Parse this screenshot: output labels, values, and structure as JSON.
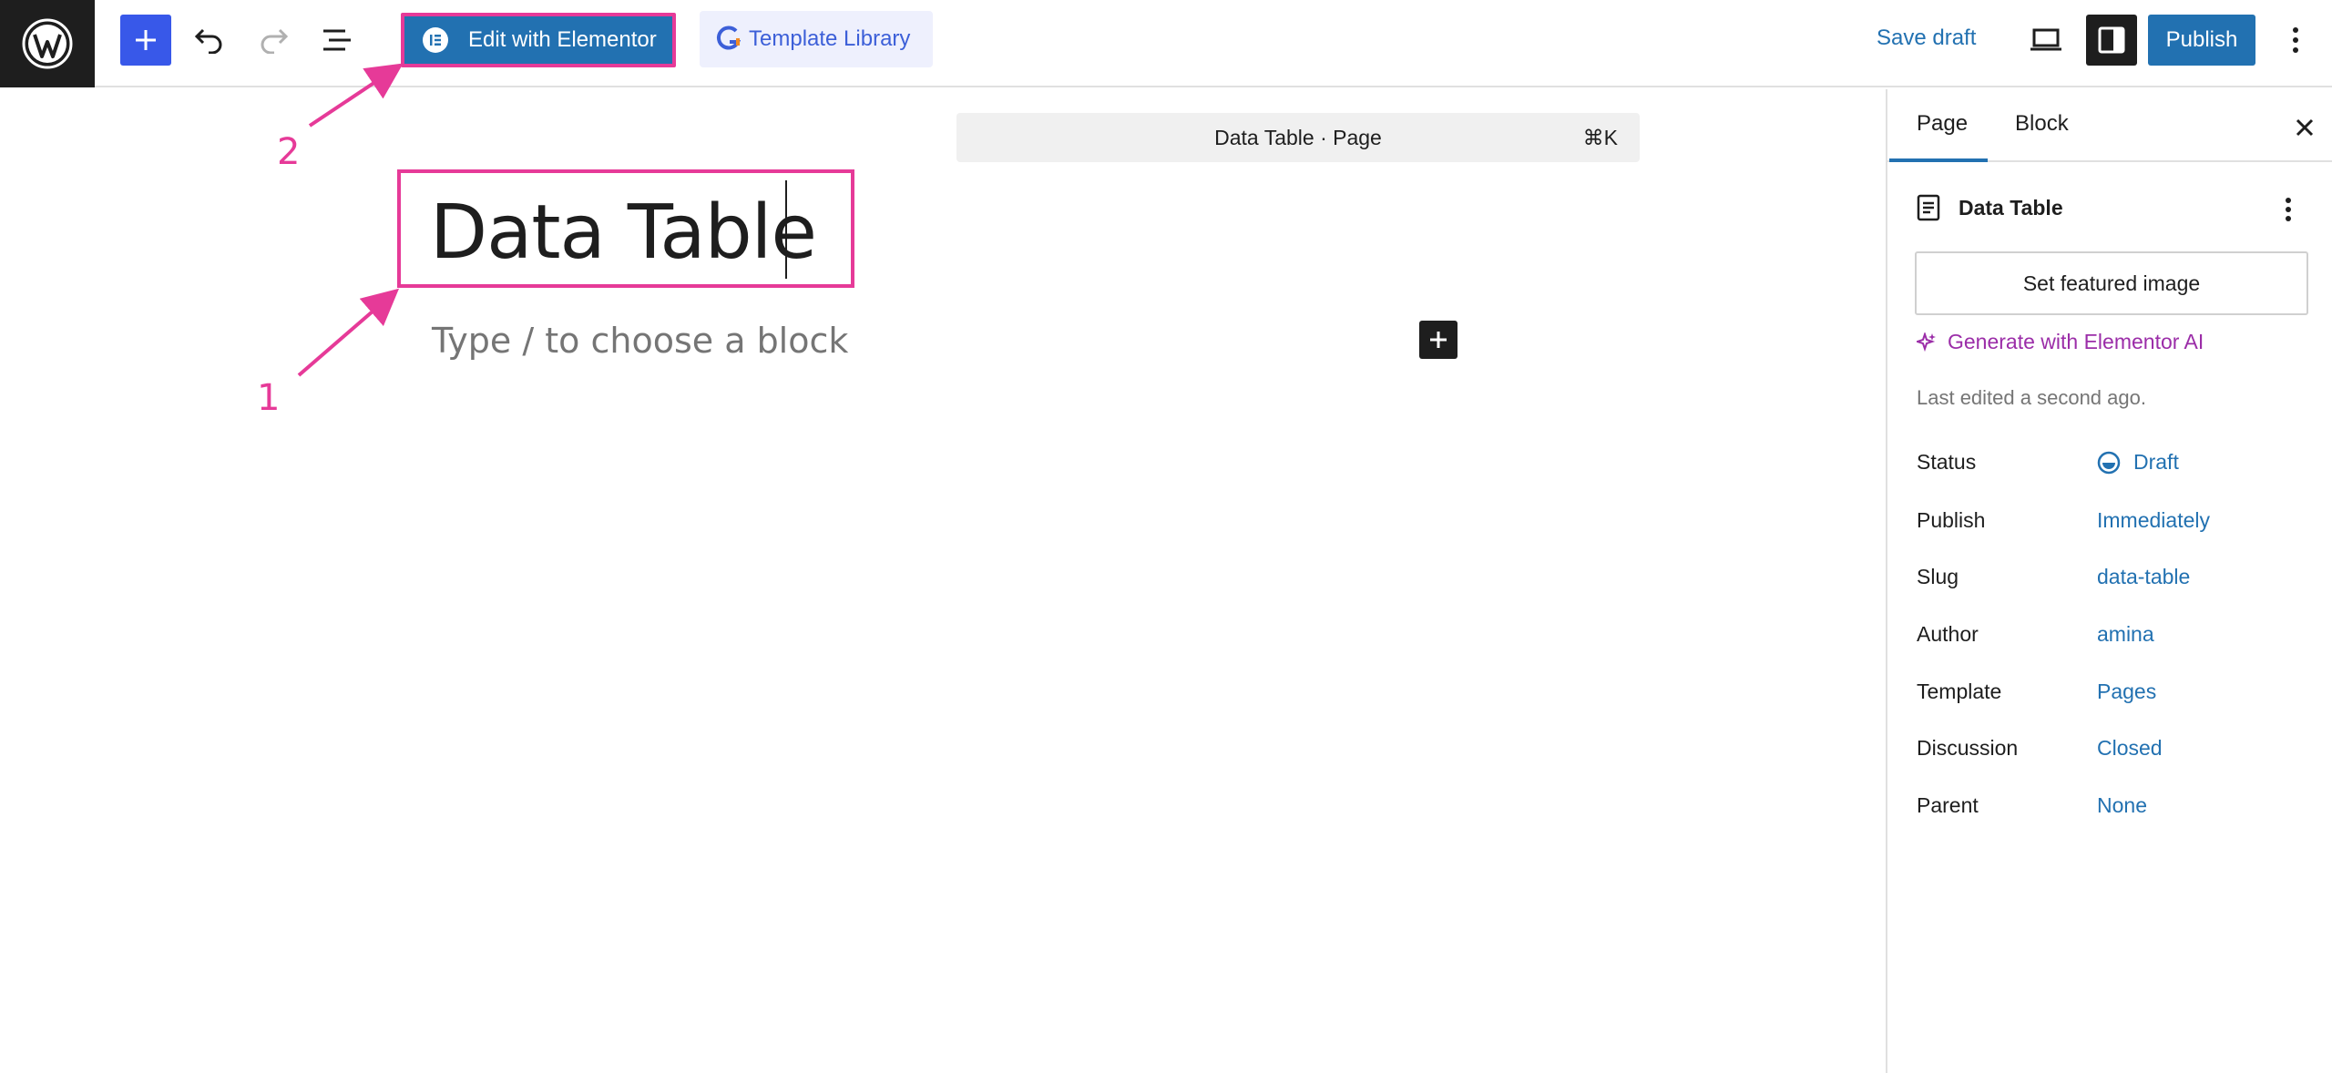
{
  "toolbar": {
    "elementor_label": "Edit with Elementor",
    "template_label": "Template Library",
    "save_draft_label": "Save draft",
    "publish_label": "Publish"
  },
  "command_bar": {
    "text": "Data Table · Page",
    "shortcut": "⌘K"
  },
  "editor": {
    "title": "Data Table",
    "placeholder": "Type / to choose a block"
  },
  "annotations": [
    "1",
    "2"
  ],
  "sidebar": {
    "tabs": [
      "Page",
      "Block"
    ],
    "active_tab": "Page",
    "doc_title": "Data Table",
    "featured_image_label": "Set featured image",
    "generate_ai_label": "Generate with Elementor AI",
    "last_edited": "Last edited a second ago.",
    "properties": [
      {
        "label": "Status",
        "value": "Draft"
      },
      {
        "label": "Publish",
        "value": "Immediately"
      },
      {
        "label": "Slug",
        "value": "data-table"
      },
      {
        "label": "Author",
        "value": "amina"
      },
      {
        "label": "Template",
        "value": "Pages"
      },
      {
        "label": "Discussion",
        "value": "Closed"
      },
      {
        "label": "Parent",
        "value": "None"
      }
    ]
  },
  "colors": {
    "accent": "#2271b1",
    "annotation": "#e63a98",
    "ai": "#9b2da8"
  }
}
